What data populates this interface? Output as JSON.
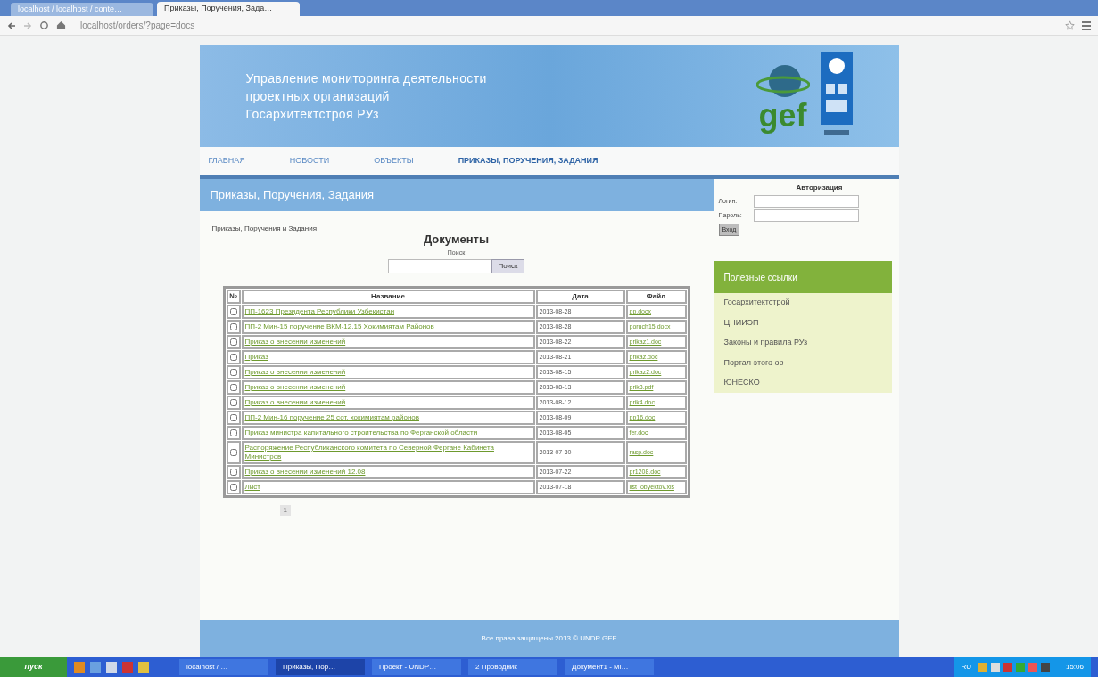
{
  "browser": {
    "tabs": [
      {
        "label": "localhost / localhost / conte…",
        "selected": false
      },
      {
        "label": "Приказы, Поручения, Зада…",
        "selected": true
      }
    ],
    "address": "localhost/orders/?page=docs"
  },
  "header": {
    "title_lines": [
      "Управление мониторинга деятельности",
      "проектных организаций",
      "Госархитектстроя РУз"
    ],
    "logo_text": "gef"
  },
  "nav": [
    {
      "label": "ГЛАВНАЯ",
      "selected": false
    },
    {
      "label": "НОВОСТИ",
      "selected": false
    },
    {
      "label": "ОБЪЕКТЫ",
      "selected": false
    },
    {
      "label": "ПРИКАЗЫ, ПОРУЧЕНИЯ, ЗАДАНИЯ",
      "selected": true
    }
  ],
  "page_title": "Приказы, Поручения, Задания",
  "breadcrumb": "Приказы, Поручения и Задания",
  "documents": {
    "heading": "Документы",
    "search_label": "Поиск",
    "search_button": "Поиск",
    "columns": [
      "№",
      "Название",
      "Дата",
      "Файл"
    ],
    "rows": [
      {
        "name": "ПП-1623 Президента Республики Узбекистан",
        "date": "2013-08-28",
        "file": "pp.docx",
        "checked": false
      },
      {
        "name": "ПП-2 Мин-15 поручение ВКМ-12.15 Хокимиятам Районов",
        "date": "2013-08-28",
        "file": "poruch15.docx",
        "checked": false
      },
      {
        "name": "Приказ о внесении изменений",
        "date": "2013-08-22",
        "file": "prikaz1.doc",
        "checked": false
      },
      {
        "name": "Приказ",
        "date": "2013-08-21",
        "file": "prikaz.doc",
        "checked": false
      },
      {
        "name": "Приказ о внесении изменений",
        "date": "2013-08-15",
        "file": "prikaz2.doc",
        "checked": false
      },
      {
        "name": "Приказ о внесении изменений",
        "date": "2013-08-13",
        "file": "prik3.pdf",
        "checked": false
      },
      {
        "name": "Приказ о внесении изменений",
        "date": "2013-08-12",
        "file": "prik4.doc",
        "checked": false
      },
      {
        "name": "ПП-2 Мин-16 поручение 25 сот. хокимиятам районов",
        "date": "2013-08-09",
        "file": "pp16.doc",
        "checked": false
      },
      {
        "name": "Приказ министра капитального строительства по Ферганской области",
        "date": "2013-08-05",
        "file": "fer.doc",
        "checked": false
      },
      {
        "name": "Распоряжение Республиканского комитета по Северной Фергане Кабинета Министров",
        "date": "2013-07-30",
        "file": "rasp.doc",
        "checked": false
      },
      {
        "name": "Приказ о внесении изменений 12.08",
        "date": "2013-07-22",
        "file": "pr1208.doc",
        "checked": false
      },
      {
        "name": "Лист",
        "date": "2013-07-18",
        "file": "list_obyektov.xls",
        "checked": false
      }
    ],
    "pages": [
      "1"
    ]
  },
  "login": {
    "heading": "Авторизация",
    "login_label": "Логин:",
    "password_label": "Пароль:",
    "button": "Вход"
  },
  "links": {
    "heading": "Полезные ссылки",
    "items": [
      "Госархитектстрой",
      "ЦНИИЭП",
      "Законы и правила РУз",
      "Портал этого ор",
      "ЮНЕСКО"
    ]
  },
  "footer": "Все права защищены 2013 © UNDP GEF",
  "taskbar": {
    "start": "пуск",
    "items": [
      {
        "label": "localhost / …",
        "selected": false
      },
      {
        "label": "Приказы, Пор…",
        "selected": true
      },
      {
        "label": "Проект - UNDP…",
        "selected": false
      },
      {
        "label": "2 Проводник",
        "selected": false
      },
      {
        "label": "Документ1 - Mi…",
        "selected": false
      }
    ],
    "lang": "RU",
    "clock": "15:06"
  }
}
